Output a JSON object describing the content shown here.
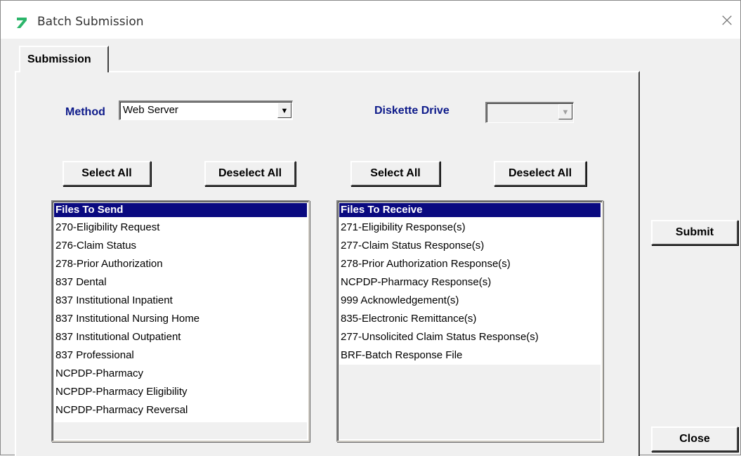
{
  "window": {
    "title": "Batch Submission",
    "close_glyph": "×"
  },
  "tabs": [
    {
      "label": "Submission",
      "active": true
    }
  ],
  "method": {
    "label": "Method",
    "value": "Web Server"
  },
  "diskette": {
    "label": "Diskette Drive",
    "value": "",
    "enabled": false
  },
  "left_buttons": {
    "select_all": "Select All",
    "deselect_all": "Deselect All"
  },
  "right_buttons": {
    "select_all": "Select All",
    "deselect_all": "Deselect All"
  },
  "files_to_send": {
    "header": "Files To Send",
    "items": [
      "270-Eligibility Request",
      "276-Claim Status",
      "278-Prior Authorization",
      "837 Dental",
      "837 Institutional Inpatient",
      "837 Institutional Nursing Home",
      "837 Institutional Outpatient",
      "837 Professional",
      "NCPDP-Pharmacy",
      "NCPDP-Pharmacy Eligibility",
      "NCPDP-Pharmacy Reversal"
    ]
  },
  "files_to_receive": {
    "header": "Files To Receive",
    "items": [
      "271-Eligibility Response(s)",
      "277-Claim Status Response(s)",
      "278-Prior Authorization Response(s)",
      "NCPDP-Pharmacy Response(s)",
      "999 Acknowledgement(s)",
      "835-Electronic Remittance(s)",
      "277-Unsolicited Claim Status Response(s)",
      "BRF-Batch Response File"
    ]
  },
  "actions": {
    "submit": "Submit",
    "close": "Close"
  },
  "colors": {
    "label_blue": "#0d1a8a",
    "list_header": "#0a0a80",
    "app_icon": "#2bb56a"
  }
}
